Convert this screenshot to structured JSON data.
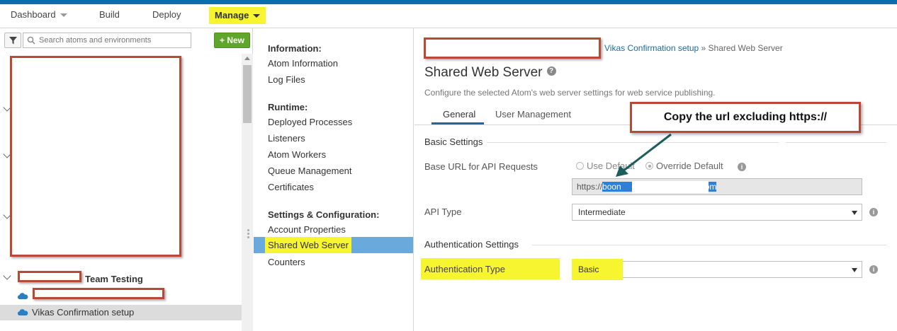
{
  "nav": {
    "dashboard": "Dashboard",
    "build": "Build",
    "deploy": "Deploy",
    "manage": "Manage"
  },
  "left_panel": {
    "search_placeholder": "Search atoms and environments",
    "new_button": "+ New",
    "team_label": "Team Testing",
    "selected_item": "Vikas Confirmation setup"
  },
  "menu": {
    "information_heading": "Information:",
    "atom_information": "Atom Information",
    "log_files": "Log Files",
    "runtime_heading": "Runtime:",
    "deployed_processes": "Deployed Processes",
    "listeners": "Listeners",
    "atom_workers": "Atom Workers",
    "queue_management": "Queue Management",
    "certificates": "Certificates",
    "settings_heading": "Settings & Configuration:",
    "account_properties": "Account Properties",
    "shared_web_server": "Shared Web Server",
    "counters": "Counters"
  },
  "main": {
    "breadcrumb_link": "Vikas Confirmation setup",
    "breadcrumb_sep": " » ",
    "breadcrumb_current": "Shared Web Server",
    "title": "Shared Web Server",
    "description": "Configure the selected Atom's web server settings for web service publishing.",
    "tabs": [
      "General",
      "User Management"
    ],
    "basic_settings": "Basic Settings",
    "base_url_label": "Base URL for API Requests",
    "radio_use_default": "Use Default",
    "radio_override_default": "Override Default",
    "url_prefix": "https://",
    "url_sel_start": "boon",
    "url_sel_end": "com",
    "api_type_label": "API Type",
    "api_type_value": "Intermediate",
    "auth_settings": "Authentication Settings",
    "auth_type_label": "Authentication Type",
    "auth_type_value": "Basic"
  },
  "annotation": {
    "callout_text": "Copy the url excluding https://"
  },
  "colors": {
    "top_bar": "#0a6fae",
    "highlight": "#f7f430",
    "menu_selected": "#6aa9dc",
    "new_button": "#5fa72b",
    "redaction_border": "#b84a35",
    "link": "#1a6aa6",
    "arrow": "#1e5d5d"
  }
}
